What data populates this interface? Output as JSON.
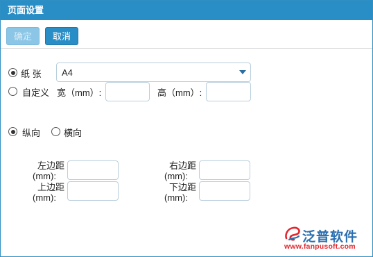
{
  "window": {
    "title": "页面设置"
  },
  "toolbar": {
    "ok_label": "确定",
    "cancel_label": "取消"
  },
  "paper": {
    "paper_label": "纸 张",
    "paper_value": "A4",
    "custom_label": "自定义",
    "width_label": "宽（mm）:",
    "height_label": "高（mm）:",
    "paper_selected": true
  },
  "orientation": {
    "portrait_label": "纵向",
    "landscape_label": "横向",
    "selected": "portrait"
  },
  "margins": {
    "left_label_1": "左边距",
    "left_label_2": "(mm):",
    "right_label_1": "右边距",
    "right_label_2": "(mm):",
    "top_label_1": "上边距",
    "top_label_2": "(mm):",
    "bottom_label_1": "下边距",
    "bottom_label_2": "(mm):"
  },
  "watermark": {
    "brand": "泛普软件",
    "url": "www.fanpusoft.com"
  }
}
